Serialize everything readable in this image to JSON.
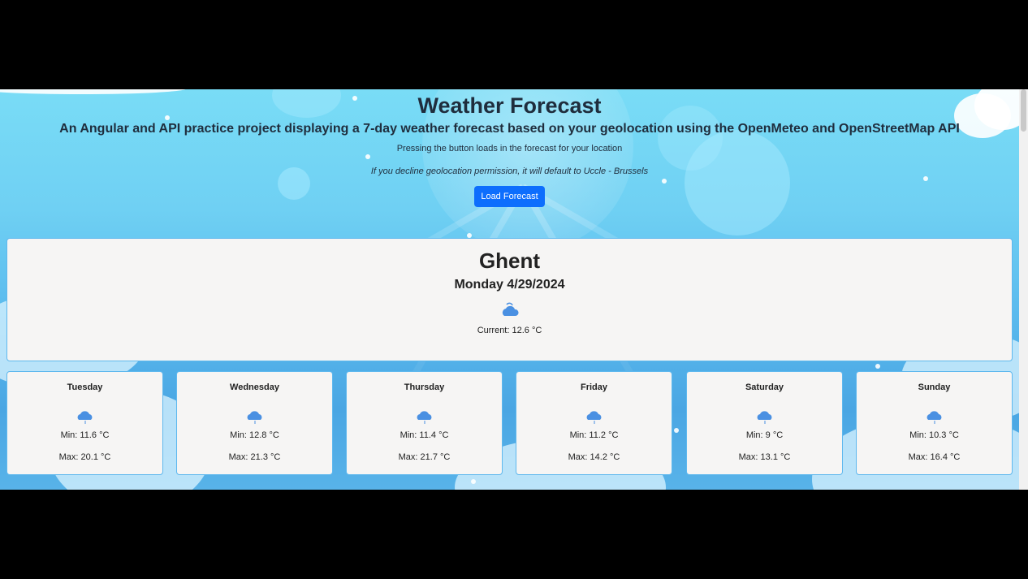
{
  "header": {
    "title": "Weather Forecast",
    "subtitle": "An Angular and API practice project displaying a 7-day weather forecast based on your geolocation using the OpenMeteo and OpenStreetMap API",
    "hint": "Pressing the button loads in the forecast for your location",
    "note": "If you decline geolocation permission, it will default to Uccle - Brussels",
    "button_label": "Load Forecast"
  },
  "current": {
    "city": "Ghent",
    "date": "Monday 4/29/2024",
    "icon": "cloud-sun-icon",
    "temperature": "Current: 12.6 °C"
  },
  "forecast": [
    {
      "day": "Tuesday",
      "icon": "cloud-rain-icon",
      "min": "Min: 11.6 °C",
      "max": "Max: 20.1 °C"
    },
    {
      "day": "Wednesday",
      "icon": "cloud-rain-icon",
      "min": "Min: 12.8 °C",
      "max": "Max: 21.3 °C"
    },
    {
      "day": "Thursday",
      "icon": "cloud-rain-icon",
      "min": "Min: 11.4 °C",
      "max": "Max: 21.7 °C"
    },
    {
      "day": "Friday",
      "icon": "cloud-rain-icon",
      "min": "Min: 11.2 °C",
      "max": "Max: 14.2 °C"
    },
    {
      "day": "Saturday",
      "icon": "cloud-rain-icon",
      "min": "Min: 9 °C",
      "max": "Max: 13.1 °C"
    },
    {
      "day": "Sunday",
      "icon": "cloud-rain-icon",
      "min": "Min: 10.3 °C",
      "max": "Max: 16.4 °C"
    }
  ],
  "colors": {
    "accent": "#0d6efd",
    "card_border": "#5eb8ee",
    "card_background": "#f6f5f4",
    "icon": "#4a90e2"
  }
}
